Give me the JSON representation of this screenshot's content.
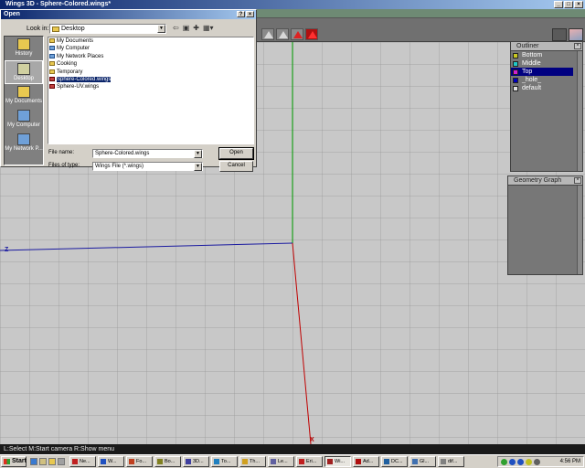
{
  "window": {
    "title": "Wings 3D - Sphere-Colored.wings*"
  },
  "viewport": {
    "axis_z_label": "Z",
    "axis_x_label": "X"
  },
  "outliner": {
    "title": "Outliner",
    "items": [
      {
        "label": "Bottom",
        "color": "#c8c820"
      },
      {
        "label": "Middle",
        "color": "#20c8c8"
      },
      {
        "label": "Top",
        "color": "#d020d0",
        "selected": true
      },
      {
        "label": "_hole_",
        "color": "#0000c0"
      },
      {
        "label": "default",
        "color": "#e0e0e0"
      }
    ]
  },
  "geometry_graph": {
    "title": "Geometry Graph"
  },
  "dialog": {
    "title": "Open",
    "look_in_label": "Look in:",
    "look_in_value": "Desktop",
    "places": [
      {
        "label": "History"
      },
      {
        "label": "Desktop",
        "selected": true
      },
      {
        "label": "My Documents"
      },
      {
        "label": "My Computer"
      },
      {
        "label": "My Network P..."
      }
    ],
    "files": [
      {
        "name": "My Documents",
        "kind": "folder"
      },
      {
        "name": "My Computer",
        "kind": "system"
      },
      {
        "name": "My Network Places",
        "kind": "system"
      },
      {
        "name": "Cooking",
        "kind": "folder"
      },
      {
        "name": "Temporary",
        "kind": "folder"
      },
      {
        "name": "Sphere-Colored.wings",
        "kind": "wings",
        "selected": true
      },
      {
        "name": "Sphere-UV.wings",
        "kind": "wings"
      }
    ],
    "file_name_label": "File name:",
    "file_name_value": "Sphere-Colored.wings",
    "files_of_type_label": "Files of type:",
    "files_of_type_value": "Wings File (*.wings)",
    "open_button": "Open",
    "cancel_button": "Cancel"
  },
  "statusbar": {
    "text": "L:Select   M:Start camera   R:Show menu"
  },
  "taskbar": {
    "start_label": "Start",
    "tasks": [
      {
        "label": "Ne...",
        "color": "#c02020"
      },
      {
        "label": "W...",
        "color": "#2050c0"
      },
      {
        "label": "Fo...",
        "color": "#c04020"
      },
      {
        "label": "Bo...",
        "color": "#808020"
      },
      {
        "label": "3D...",
        "color": "#4040a0"
      },
      {
        "label": "To...",
        "color": "#2080c0"
      },
      {
        "label": "Th...",
        "color": "#d0a020"
      },
      {
        "label": "Le...",
        "color": "#6060a0"
      },
      {
        "label": "Eri...",
        "color": "#c02020"
      },
      {
        "label": "Wi...",
        "color": "#a02020",
        "active": true
      },
      {
        "label": "Ad...",
        "color": "#b01010"
      },
      {
        "label": "DC...",
        "color": "#2060a0"
      },
      {
        "label": "Gl...",
        "color": "#4070b0"
      },
      {
        "label": "dif...",
        "color": "#808080"
      }
    ],
    "clock": "4:56 PM"
  }
}
